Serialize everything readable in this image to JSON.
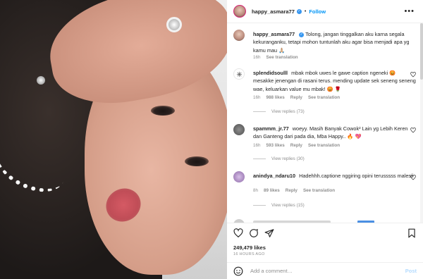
{
  "header": {
    "username": "happy_asmara77",
    "separator": "•",
    "follow_label": "Follow",
    "more_label": "•••"
  },
  "caption": {
    "username": "happy_asmara77",
    "text": "Tolong, jangan tinggalkan aku karna segala kekuranganku, tetapi mohon tuntunlah aku agar bisa menjadi apa yg kamu mau 🙏🏼",
    "age": "16h",
    "see_translation": "See translation"
  },
  "comments": [
    {
      "username": "splendidsoulll",
      "text": "mbak mbok uwes le gawe caption ngeneki 😡 mesakke jenengan di rasani terus. mending update sek seneng seneng wae, keluarkan value mu mbak! 😡 🌹",
      "age": "16h",
      "likes": "988 likes",
      "reply": "Reply",
      "see_translation": "See translation",
      "view_replies": "View replies (73)"
    },
    {
      "username": "spammm_jr.77",
      "text": "woeyy. Masih Banyak Cowok² Lain yg Lebih Keren dan Ganteng dari pada dia, Mba Happy.. 🔥 💖",
      "age": "16h",
      "likes": "593 likes",
      "reply": "Reply",
      "see_translation": "See translation",
      "view_replies": "View replies (30)"
    },
    {
      "username": "anindya_ndaru10",
      "text": "Hadehhh.captione nggiring opini terusssss malesii",
      "age": "8h",
      "likes": "89 likes",
      "reply": "Reply",
      "see_translation": "See translation",
      "view_replies": "View replies (15)"
    }
  ],
  "footer": {
    "likes": "249,479 likes",
    "time": "16 HOURS AGO",
    "add_comment_placeholder": "Add a comment…",
    "post_label": "Post"
  },
  "colors": {
    "accent_blue": "#0095f6",
    "text": "#262626",
    "muted": "#8e8e8e",
    "post_disabled": "#b3dbff"
  },
  "icons": [
    "more-icon",
    "verified-icon",
    "heart-icon",
    "comment-icon",
    "share-icon",
    "bookmark-icon",
    "emoji-icon"
  ]
}
